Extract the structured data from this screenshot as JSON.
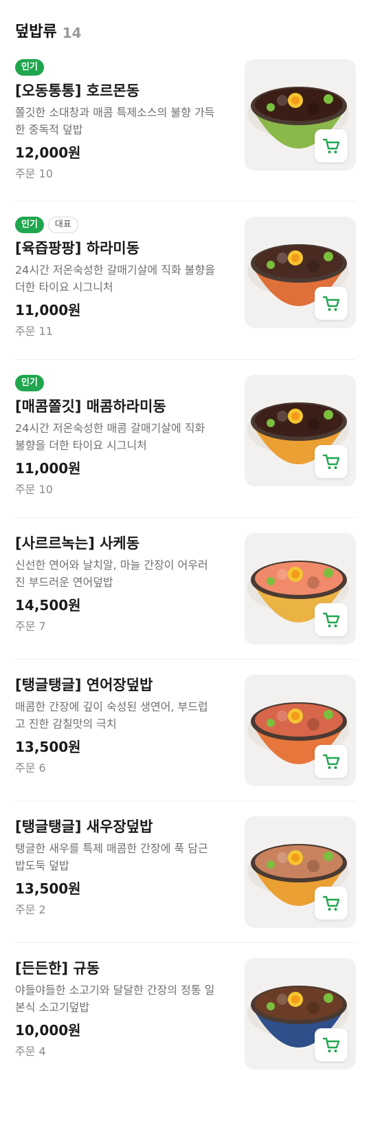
{
  "section": {
    "title": "덮밥류",
    "count": "14"
  },
  "colors": {
    "accent": "#1fa64e",
    "muted": "#9a9a9a"
  },
  "items": [
    {
      "badges": [
        "인기"
      ],
      "name": "[오동통통] 호르몬동",
      "desc": "쫄깃한 소대창과 매콤 특제소스의 불향 가득한 중독적 덮밥",
      "price": "12,000원",
      "orders": "주문 10",
      "bowl": "#8ab84a",
      "topping": "#3a1d14"
    },
    {
      "badges": [
        "인기",
        "대표"
      ],
      "name": "[육즙팡팡] 하라미동",
      "desc": "24시간 저온숙성한 갈매기살에 직화 불향을 더한 타이요 시그니처",
      "price": "11,000원",
      "orders": "주문 11",
      "bowl": "#e0703a",
      "topping": "#4a2b22"
    },
    {
      "badges": [
        "인기"
      ],
      "name": "[매콤쫄깃] 매콤하라미동",
      "desc": "24시간 저온숙성한 매콤 갈매기살에 직화 불향을 더한 타이요 시그니처",
      "price": "11,000원",
      "orders": "주문 10",
      "bowl": "#eaa032",
      "topping": "#3b1f18"
    },
    {
      "badges": [],
      "name": "[사르르녹는] 사케동",
      "desc": "신선한 연어와 날치알, 마늘 간장이 어우러진 부드러운 연어덮밥",
      "price": "14,500원",
      "orders": "주문 7",
      "bowl": "#ebb244",
      "topping": "#f08a6a"
    },
    {
      "badges": [],
      "name": "[탱글탱글] 연어장덮밥",
      "desc": "매콤한 간장에 깊이 숙성된 생연어, 부드럽고 진한 감칠맛의 극치",
      "price": "13,500원",
      "orders": "주문 6",
      "bowl": "#e6763c",
      "topping": "#d8664a"
    },
    {
      "badges": [],
      "name": "[탱글탱글] 새우장덮밥",
      "desc": "탱글한 새우를 특제 매콤한 간장에 푹 담근 밥도둑 덮밥",
      "price": "13,500원",
      "orders": "주문 2",
      "bowl": "#eaa032",
      "topping": "#c9825e"
    },
    {
      "badges": [],
      "name": "[든든한] 규동",
      "desc": "야들야들한 소고기와 달달한 간장의 정통 일본식 소고기덮밥",
      "price": "10,000원",
      "orders": "주문 4",
      "bowl": "#2f4f8a",
      "topping": "#6b3d26"
    }
  ]
}
